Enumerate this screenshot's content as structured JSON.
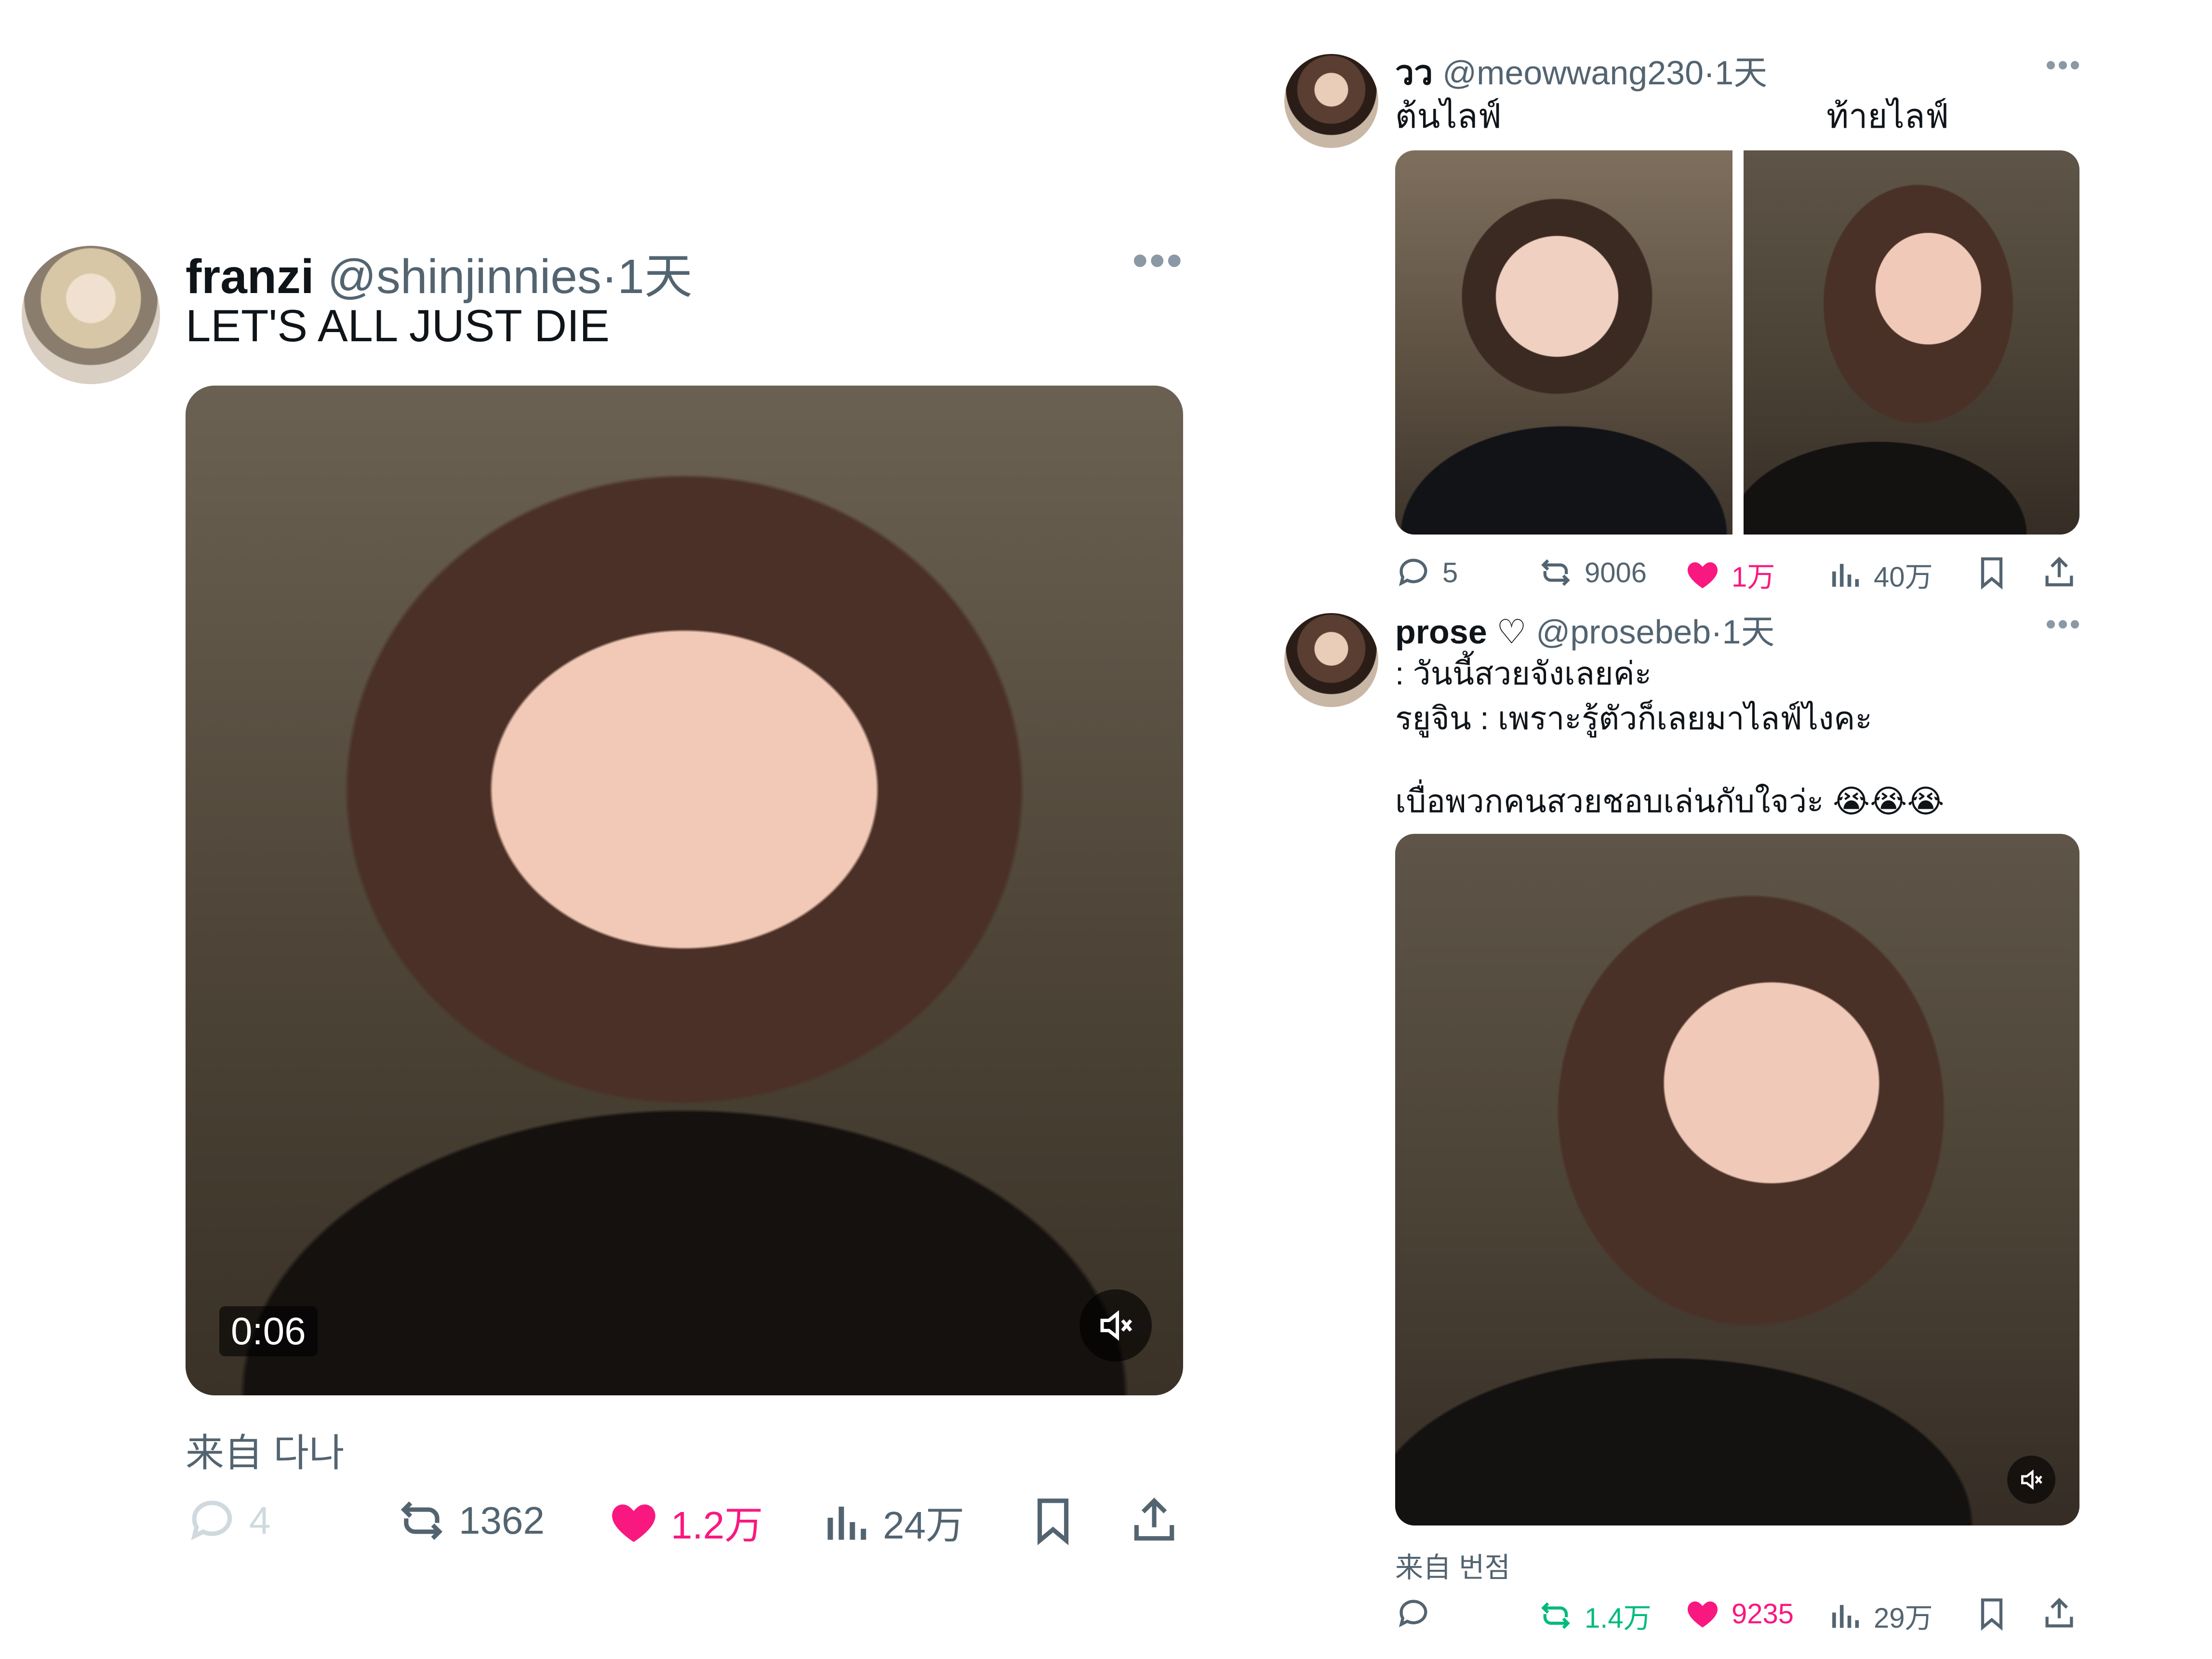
{
  "post_left": {
    "display_name": "franzi",
    "handle": "@shinjinnies",
    "time": "·1天",
    "text": "LET'S ALL JUST DIE",
    "video_duration": "0:06",
    "source": "来自 다나",
    "replies": "4",
    "retweets": "1362",
    "likes": "1.2万",
    "views": "24万"
  },
  "post_top_right": {
    "display_name": "วว",
    "handle": "@meowwang230",
    "time": "·1天",
    "caption_left": "ต้นไลฟ์",
    "caption_right": "ท้ายไลฟ์",
    "replies": "5",
    "retweets": "9006",
    "likes": "1万",
    "views": "40万"
  },
  "post_bottom_right": {
    "display_name": "prose ♡",
    "handle": "@prosebeb",
    "time": "·1天",
    "text_line1": ": วันนี้สวยจังเลยค่ะ",
    "text_line2": "รยูจิน : เพราะรู้ตัวก็เลยมาไลฟ์ไงคะ",
    "text_line3": "เบื่อพวกคนสวยชอบเล่นกับใจว่ะ 😭😭😭",
    "source": "来自 번점",
    "retweets": "1.4万",
    "likes": "9235",
    "views": "29万"
  },
  "colors": {
    "like": "#f91880",
    "retweet_active": "#00ba7c",
    "muted": "#536471"
  }
}
